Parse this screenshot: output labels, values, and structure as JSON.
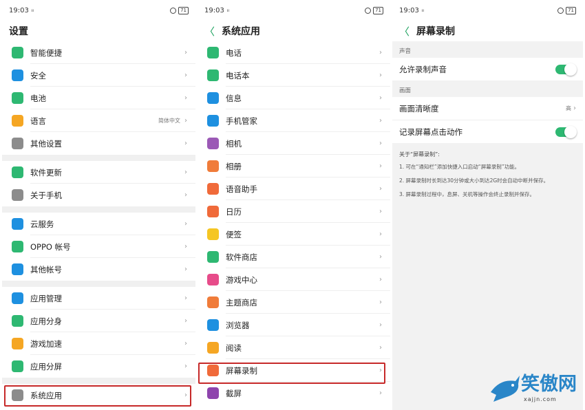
{
  "status": {
    "time": "19:03",
    "signal": "ᵢₗ ᵢₗ",
    "battery": "71"
  },
  "panel1": {
    "title": "设置",
    "groups": [
      [
        {
          "label": "智能便捷",
          "icon": "smart-icon",
          "color": "#2eb872"
        },
        {
          "label": "安全",
          "icon": "shield-icon",
          "color": "#1e90e0"
        },
        {
          "label": "电池",
          "icon": "battery-icon",
          "color": "#2eb872"
        },
        {
          "label": "语言",
          "icon": "language-icon",
          "color": "#f5a623",
          "value": "简体中文"
        },
        {
          "label": "其他设置",
          "icon": "gear-icon",
          "color": "#8c8c8c"
        }
      ],
      [
        {
          "label": "软件更新",
          "icon": "update-icon",
          "color": "#2eb872"
        },
        {
          "label": "关于手机",
          "icon": "info-icon",
          "color": "#8c8c8c"
        }
      ],
      [
        {
          "label": "云服务",
          "icon": "cloud-icon",
          "color": "#1e90e0"
        },
        {
          "label": "OPPO 帐号",
          "icon": "account-icon",
          "color": "#2eb872"
        },
        {
          "label": "其他帐号",
          "icon": "user-icon",
          "color": "#1e90e0"
        }
      ],
      [
        {
          "label": "应用管理",
          "icon": "apps-icon",
          "color": "#1e90e0"
        },
        {
          "label": "应用分身",
          "icon": "clone-icon",
          "color": "#2eb872"
        },
        {
          "label": "游戏加速",
          "icon": "gamepad-icon",
          "color": "#f5a623"
        },
        {
          "label": "应用分屏",
          "icon": "split-icon",
          "color": "#2eb872"
        }
      ],
      [
        {
          "label": "系统应用",
          "icon": "gear-icon",
          "color": "#8c8c8c"
        }
      ]
    ]
  },
  "panel2": {
    "title": "系统应用",
    "items": [
      {
        "label": "电话",
        "icon": "phone-icon",
        "color": "#2eb872"
      },
      {
        "label": "电话本",
        "icon": "contacts-icon",
        "color": "#2eb872"
      },
      {
        "label": "信息",
        "icon": "message-icon",
        "color": "#1e90e0"
      },
      {
        "label": "手机管家",
        "icon": "shield-icon",
        "color": "#1e90e0"
      },
      {
        "label": "相机",
        "icon": "camera-icon",
        "color": "#9b59b6"
      },
      {
        "label": "相册",
        "icon": "photo-icon",
        "color": "#f07c3a"
      },
      {
        "label": "语音助手",
        "icon": "mic-icon",
        "color": "#f06a3a"
      },
      {
        "label": "日历",
        "icon": "calendar-icon",
        "color": "#f06a3a"
      },
      {
        "label": "便签",
        "icon": "note-icon",
        "color": "#f5c623"
      },
      {
        "label": "软件商店",
        "icon": "store-icon",
        "color": "#2eb872"
      },
      {
        "label": "游戏中心",
        "icon": "star-icon",
        "color": "#e74c8a"
      },
      {
        "label": "主题商店",
        "icon": "palette-icon",
        "color": "#f07c3a"
      },
      {
        "label": "浏览器",
        "icon": "browser-icon",
        "color": "#1e90e0"
      },
      {
        "label": "阅读",
        "icon": "book-icon",
        "color": "#f5a623"
      },
      {
        "label": "屏幕录制",
        "icon": "video-icon",
        "color": "#f06a3a"
      },
      {
        "label": "截屏",
        "icon": "screenshot-icon",
        "color": "#8e44ad"
      }
    ]
  },
  "panel3": {
    "title": "屏幕录制",
    "sec_sound": "声音",
    "allow_sound": "允许录制声音",
    "sec_picture": "画面",
    "clarity": "画面清晰度",
    "clarity_value": "高",
    "record_touch": "记录屏幕点击动作",
    "about_title": "关于“屏幕录制”:",
    "notes": [
      "1. 可在“通知栏”添加快捷入口启动“屏幕录制”功能。",
      "2. 屏幕录制时长到达30分钟或大小到达2G时会自动中断并保存。",
      "3. 屏幕录制过程中，息屏、关机等操作会终止录制并保存。"
    ]
  },
  "watermark": {
    "text": "笑傲网",
    "url": "xajjn.com"
  },
  "accent": "#2eb872",
  "highlight": "#c62828"
}
